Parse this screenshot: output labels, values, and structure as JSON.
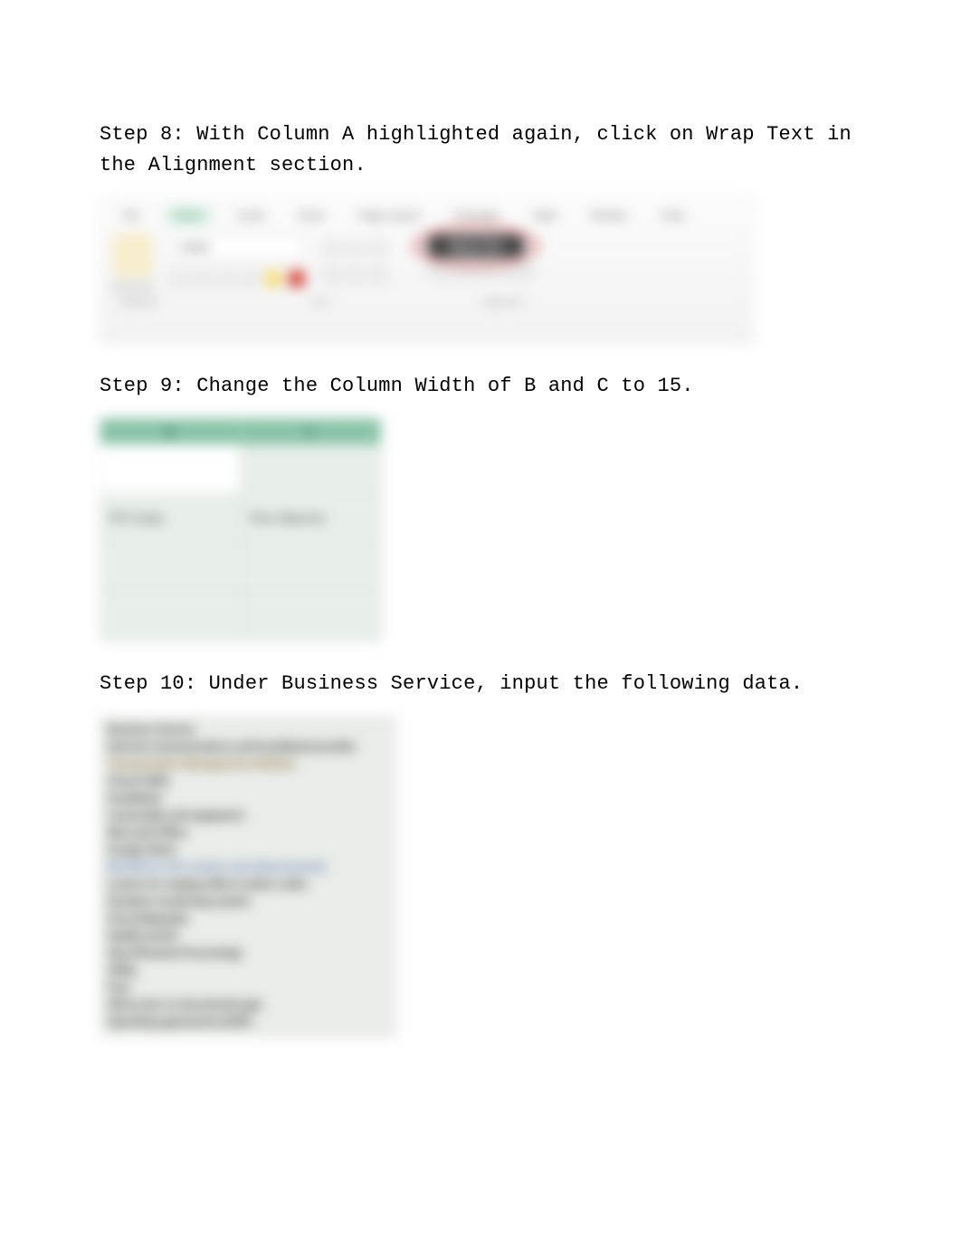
{
  "steps": {
    "s8": {
      "label": "Step 8:  ",
      "body": "With Column A highlighted again, click on Wrap Text in the Alignment section."
    },
    "s9": {
      "label": "Step 9:  ",
      "body": "Change the Column Width of B and C to 15."
    },
    "s10": {
      "label": "Step 10:  ",
      "body": "Under Business Service, input the following data."
    }
  },
  "ribbon": {
    "tabs": [
      "File",
      "Home",
      "Insert",
      "Draw",
      "Page Layout",
      "Formulas",
      "Data",
      "Review",
      "View"
    ],
    "active_tab_index": 1,
    "font_name": "Calibri",
    "wrap_text_label": "Wrap Text",
    "group_labels": [
      "Clipboard",
      "Font",
      "Alignment"
    ]
  },
  "columns_preview": {
    "headers": [
      "B",
      "C"
    ],
    "row2": [
      "RTO (day)",
      "Plan Objective"
    ]
  },
  "business_service_list": [
    "Business Service",
    "Internal communications and broadband provider",
    "Transportation Management Software",
    "Church Bills",
    "Facilitation",
    "Commodity and equipment",
    "Microsoft Office",
    "Google Sheet",
    "MS ERP (is A/P, vendors and disbursement)",
    "Leisure for reading office/ vendor codes",
    "Donation monitoring system",
    "Server/laptop(s)",
    "Saddle printer",
    "Ops (Pinnacle Processing)",
    "Utility",
    "Fuel",
    "SW (Locks on documents) app",
    "Operating agreements (SOP)"
  ]
}
